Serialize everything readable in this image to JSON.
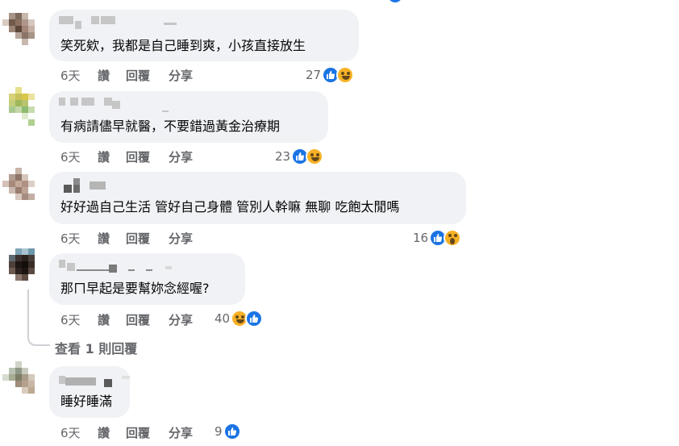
{
  "comments": [
    {
      "text": "笑死欸，我都是自己睡到爽，小孩直接放生",
      "time": "6天",
      "like": "讚",
      "reply": "回覆",
      "share": "分享",
      "reaction_count": "27",
      "reactions": [
        "like-icon",
        "haha-icon"
      ]
    },
    {
      "text": "有病請儘早就醫，不要錯過黃金治療期",
      "time": "6天",
      "like": "讚",
      "reply": "回覆",
      "share": "分享",
      "reaction_count": "23",
      "reactions": [
        "like-icon",
        "haha-icon"
      ]
    },
    {
      "text": "好好過自己生活 管好自己身體 管別人幹嘛 無聊 吃飽太閒嗎",
      "time": "6天",
      "like": "讚",
      "reply": "回覆",
      "share": "分享",
      "reaction_count": "16",
      "reactions": [
        "like-icon",
        "wow-icon"
      ]
    },
    {
      "text": "那ㄇ早起是要幫妳念經喔?",
      "time": "6天",
      "like": "讚",
      "reply": "回覆",
      "share": "分享",
      "reaction_count": "40",
      "reactions": [
        "haha-icon",
        "like-icon"
      ]
    },
    {
      "text": "睡好睡滿",
      "time": "6天",
      "like": "讚",
      "reply": "回覆",
      "share": "分享",
      "reaction_count": "9",
      "reactions": [
        "like-icon"
      ]
    }
  ],
  "view_replies": "查看 1 則回覆",
  "colors": {
    "bubble": "#f0f2f5",
    "meta": "#65676b",
    "like_blue": "#1b74e4",
    "emoji_yellow": "#f7b125"
  }
}
